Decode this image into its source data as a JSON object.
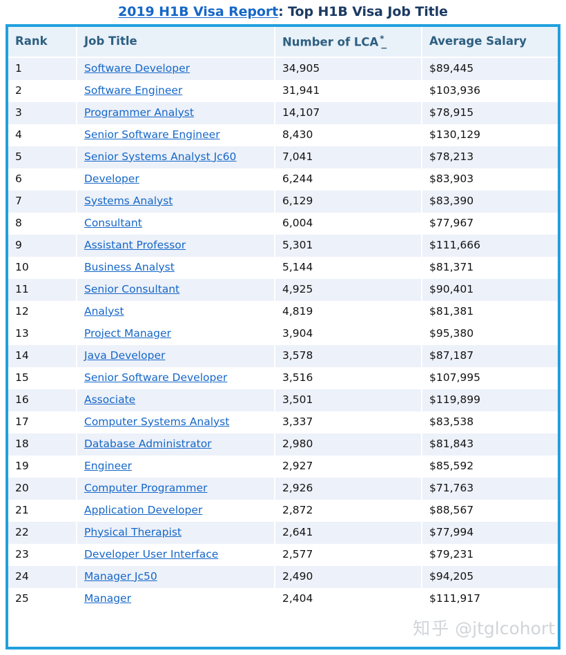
{
  "title": {
    "link_text": "2019 H1B Visa Report",
    "rest_text": ": Top H1B Visa Job Title"
  },
  "colors": {
    "table_border": "#20a0dd",
    "header_bg": "#e9f1f9",
    "header_text": "#2d5f80",
    "link": "#1567c8",
    "row_shaded": "#edf1f9",
    "row_plain": "#ffffff",
    "title_dark": "#1b3a63",
    "watermark": "#c9cdd2"
  },
  "table": {
    "columns": [
      {
        "key": "rank",
        "label": "Rank",
        "sortable": true,
        "sup": "",
        "dash": ""
      },
      {
        "key": "job_title",
        "label": "Job Title",
        "sortable": true,
        "sup": "",
        "dash": ""
      },
      {
        "key": "number_of_lca",
        "label": "Number of LCA",
        "sortable": true,
        "sup": "*",
        "dash": "_"
      },
      {
        "key": "average_salary",
        "label": "Average Salary",
        "sortable": true,
        "sup": "",
        "dash": ""
      }
    ],
    "rows": [
      {
        "rank": "1",
        "job_title": "Software Developer",
        "number_of_lca": "34,905",
        "average_salary": "$89,445",
        "shaded": true
      },
      {
        "rank": "2",
        "job_title": "Software Engineer",
        "number_of_lca": "31,941",
        "average_salary": "$103,936",
        "shaded": false
      },
      {
        "rank": "3",
        "job_title": "Programmer Analyst",
        "number_of_lca": "14,107",
        "average_salary": "$78,915",
        "shaded": true
      },
      {
        "rank": "4",
        "job_title": "Senior Software Engineer",
        "number_of_lca": "8,430",
        "average_salary": "$130,129",
        "shaded": false
      },
      {
        "rank": "5",
        "job_title": "Senior Systems Analyst Jc60",
        "number_of_lca": "7,041",
        "average_salary": "$78,213",
        "shaded": true
      },
      {
        "rank": "6",
        "job_title": "Developer",
        "number_of_lca": "6,244",
        "average_salary": "$83,903",
        "shaded": false
      },
      {
        "rank": "7",
        "job_title": "Systems Analyst",
        "number_of_lca": "6,129",
        "average_salary": "$83,390",
        "shaded": true
      },
      {
        "rank": "8",
        "job_title": "Consultant",
        "number_of_lca": "6,004",
        "average_salary": "$77,967",
        "shaded": false
      },
      {
        "rank": "9",
        "job_title": "Assistant Professor",
        "number_of_lca": "5,301",
        "average_salary": "$111,666",
        "shaded": true
      },
      {
        "rank": "10",
        "job_title": "Business Analyst",
        "number_of_lca": "5,144",
        "average_salary": "$81,371",
        "shaded": false
      },
      {
        "rank": "11",
        "job_title": "Senior Consultant",
        "number_of_lca": "4,925",
        "average_salary": "$90,401",
        "shaded": true
      },
      {
        "rank": "12",
        "job_title": "Analyst",
        "number_of_lca": "4,819",
        "average_salary": "$81,381",
        "shaded": false
      },
      {
        "rank": "13",
        "job_title": "Project Manager",
        "number_of_lca": "3,904",
        "average_salary": "$95,380",
        "shaded": false
      },
      {
        "rank": "14",
        "job_title": "Java Developer",
        "number_of_lca": "3,578",
        "average_salary": "$87,187",
        "shaded": true
      },
      {
        "rank": "15",
        "job_title": "Senior Software Developer",
        "number_of_lca": "3,516",
        "average_salary": "$107,995",
        "shaded": false
      },
      {
        "rank": "16",
        "job_title": "Associate",
        "number_of_lca": "3,501",
        "average_salary": "$119,899",
        "shaded": true
      },
      {
        "rank": "17",
        "job_title": "Computer Systems Analyst",
        "number_of_lca": "3,337",
        "average_salary": "$83,538",
        "shaded": false
      },
      {
        "rank": "18",
        "job_title": "Database Administrator",
        "number_of_lca": "2,980",
        "average_salary": "$81,843",
        "shaded": true
      },
      {
        "rank": "19",
        "job_title": "Engineer",
        "number_of_lca": "2,927",
        "average_salary": "$85,592",
        "shaded": false
      },
      {
        "rank": "20",
        "job_title": "Computer Programmer",
        "number_of_lca": "2,926",
        "average_salary": "$71,763",
        "shaded": true
      },
      {
        "rank": "21",
        "job_title": "Application Developer",
        "number_of_lca": "2,872",
        "average_salary": "$88,567",
        "shaded": false
      },
      {
        "rank": "22",
        "job_title": "Physical Therapist",
        "number_of_lca": "2,641",
        "average_salary": "$77,994",
        "shaded": true
      },
      {
        "rank": "23",
        "job_title": "Developer User Interface",
        "number_of_lca": "2,577",
        "average_salary": "$79,231",
        "shaded": false
      },
      {
        "rank": "24",
        "job_title": "Manager Jc50",
        "number_of_lca": "2,490",
        "average_salary": "$94,205",
        "shaded": true
      },
      {
        "rank": "25",
        "job_title": "Manager",
        "number_of_lca": "2,404",
        "average_salary": "$111,917",
        "shaded": false
      }
    ]
  },
  "watermark": {
    "cn": "知乎",
    "handle": "@jtglcohort"
  }
}
